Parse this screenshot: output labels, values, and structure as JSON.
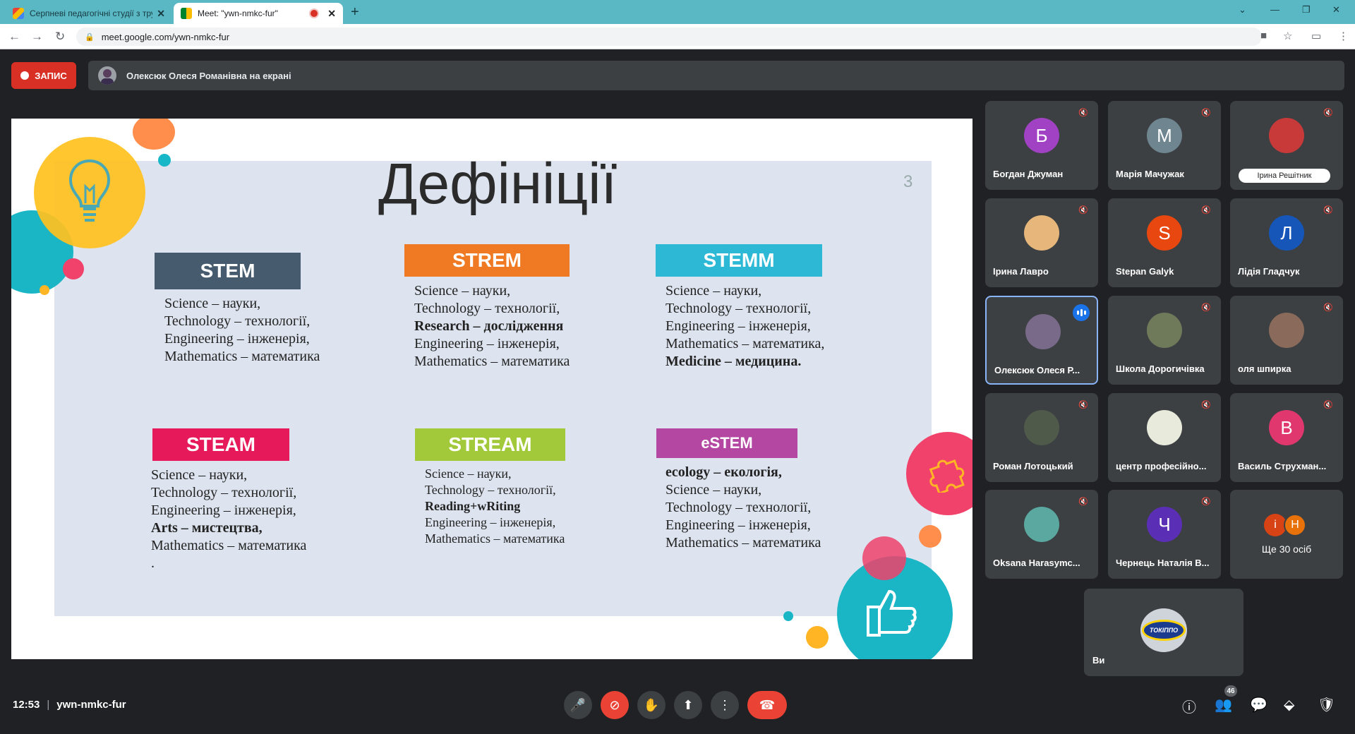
{
  "browser": {
    "tabs": [
      {
        "title": "Серпневі педагогічні студії з тру...",
        "favicon": "gmail-icon"
      },
      {
        "title": "Meet: \"ywn-nmkc-fur\"",
        "favicon": "google-meet-icon"
      }
    ],
    "new_tab": "+",
    "url": "meet.google.com/ywn-nmkc-fur"
  },
  "meet": {
    "record_label": "ЗАПИС",
    "presenting_text": "Олексюк Олеся Романівна на екрані",
    "time": "12:53",
    "meeting_code": "ywn-nmkc-fur",
    "participants_count": "46"
  },
  "slide": {
    "title": "Дефініції",
    "page_number": "3",
    "blocks": [
      {
        "label": "STEM",
        "color": "#465b6e",
        "lines": [
          "Science –  науки,",
          "Technology – технології,",
          "Engineering – інженерія,",
          "Mathematics – математика"
        ],
        "bold": []
      },
      {
        "label": "STREM",
        "color": "#ef7a23",
        "lines": [
          "Science –  науки,",
          "Technology – технології,",
          "Research – дослідження",
          "Engineering – інженерія,",
          "Mathematics – математика"
        ],
        "bold": [
          2
        ]
      },
      {
        "label": "STEMM",
        "color": "#2db9d6",
        "lines": [
          "Science –  науки,",
          "Technology – технології,",
          "Engineering – інженерія,",
          "Mathematics – математика,",
          "Medicine – медицина."
        ],
        "bold": [
          4
        ]
      },
      {
        "label": "STEAM",
        "color": "#e6195a",
        "lines": [
          "Science –  науки,",
          "Technology – технології,",
          "Engineering – інженерія,",
          "Arts – мистецтва,",
          "Mathematics – математика",
          "."
        ],
        "bold": [
          3
        ]
      },
      {
        "label": "STREAM",
        "color": "#a2c93a",
        "lines": [
          "Science –  науки,",
          "Technology – технології,",
          "Reading+wRiting",
          "Engineering – інженерія,",
          "Mathematics – математика"
        ],
        "bold": [
          2
        ]
      },
      {
        "label": "eSTEM",
        "color": "#b347a2",
        "lines": [
          "ecology – екологія,",
          "Science –  науки,",
          "Technology – технології,",
          "Engineering – інженерія,",
          "Mathematics – математика"
        ],
        "bold": [
          0
        ]
      }
    ]
  },
  "participants": [
    {
      "name": "Богдан Джуман",
      "initial": "Б",
      "color": "#a142c4",
      "muted": true
    },
    {
      "name": "Марія Мачужак",
      "initial": "М",
      "color": "#6f8590",
      "muted": true
    },
    {
      "name": "Ірина Решітник",
      "initial": "",
      "color": "#c83a3a",
      "muted": true,
      "pill": true
    },
    {
      "name": "Ірина Лавро",
      "initial": "",
      "color": "#e6b67a",
      "muted": true
    },
    {
      "name": "Stepan Galyk",
      "initial": "S",
      "color": "#e8470f",
      "muted": true
    },
    {
      "name": "Лідія Гладчук",
      "initial": "Л",
      "color": "#1556b8",
      "muted": true
    },
    {
      "name": "Олексюк Олеся Р...",
      "initial": "",
      "color": "#7a6a8a",
      "muted": false,
      "speaking": true
    },
    {
      "name": "Школа Дорогичівка",
      "initial": "",
      "color": "#6f7a5a",
      "muted": true
    },
    {
      "name": "оля шпирка",
      "initial": "",
      "color": "#8a6a5a",
      "muted": true
    },
    {
      "name": "Роман Лотоцький",
      "initial": "",
      "color": "#4f5a4a",
      "muted": true
    },
    {
      "name": "центр професійно...",
      "initial": "",
      "color": "#e8eadc",
      "muted": true
    },
    {
      "name": "Василь Струхман...",
      "initial": "В",
      "color": "#e0376f",
      "muted": true
    },
    {
      "name": "Oksana Harasymc...",
      "initial": "",
      "color": "#5aa8a0",
      "muted": true
    },
    {
      "name": "Чернець Наталія В...",
      "initial": "Ч",
      "color": "#5b2fb5",
      "muted": true
    }
  ],
  "more": {
    "label": "Ще 30 осіб",
    "initials": [
      "і",
      "Н"
    ],
    "colors": [
      "#d84315",
      "#e8710a"
    ]
  },
  "self": {
    "name": "Ви",
    "logo": "ТОКІППО"
  }
}
